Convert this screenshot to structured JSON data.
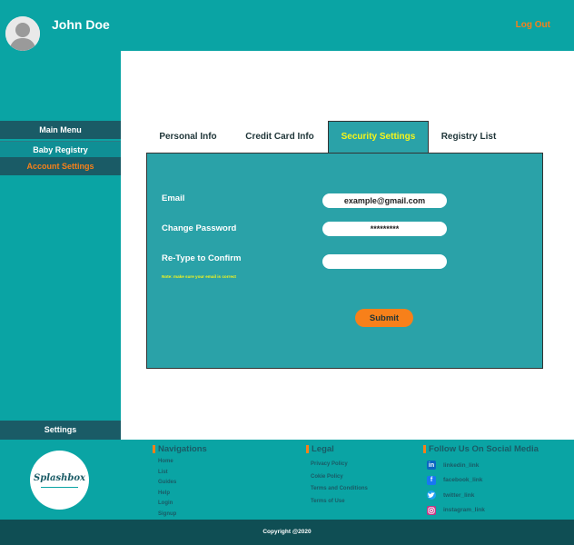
{
  "header": {
    "username": "John Doe",
    "logout_label": "Log Out"
  },
  "sidebar": {
    "main_menu": "Main Menu",
    "items": [
      {
        "label": "Baby Registry"
      },
      {
        "label": "Account Settings",
        "active": true
      }
    ],
    "settings": "Settings"
  },
  "tabs": [
    {
      "label": "Personal Info"
    },
    {
      "label": "Credit Card Info"
    },
    {
      "label": "Security Settings",
      "active": true
    },
    {
      "label": "Registry List"
    }
  ],
  "form": {
    "email_label": "Email",
    "email_value": "example@gmail.com",
    "password_label": "Change Password",
    "password_value": "*********",
    "retype_label": "Re-Type to Confirm",
    "retype_value": "",
    "note": "Note: make sure your email is correct",
    "submit_label": "Submit"
  },
  "footer": {
    "logo_text": "Splashbox",
    "navigations": {
      "heading": "Navigations",
      "links": [
        "Home",
        "List",
        "Guides",
        "Help",
        "Login",
        "Signup"
      ]
    },
    "legal": {
      "heading": "Legal",
      "links": [
        "Privacy Policy",
        "Cokie Policy",
        "Terms and Conditions",
        "Terms of Use"
      ]
    },
    "social": {
      "heading": "Follow Us On Social Media",
      "links": [
        {
          "label": "linkedin_link",
          "icon": "linkedin-icon",
          "color": "#0a66c2"
        },
        {
          "label": "facebook_link",
          "icon": "facebook-icon",
          "color": "#1877f2"
        },
        {
          "label": "twitter_link",
          "icon": "twitter-icon",
          "color": "#1da1f2"
        },
        {
          "label": "instagram_link",
          "icon": "instagram-icon",
          "color": "#c13584"
        }
      ]
    },
    "copyright": "Copyright @2020"
  },
  "colors": {
    "teal": "#0aa4a4",
    "dark_teal": "#1a5b66",
    "accent_orange": "#f7801a",
    "accent_yellow": "#f6f51a",
    "panel_teal": "#2aa2a8"
  }
}
